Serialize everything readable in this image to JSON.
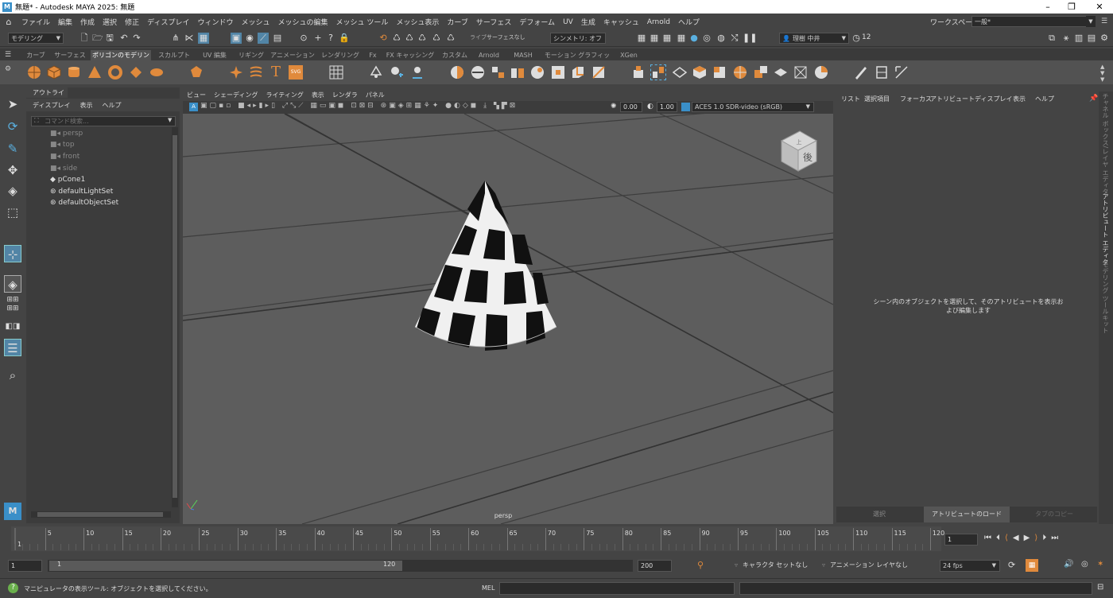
{
  "window": {
    "title": "無題* - Autodesk MAYA 2025: 無題",
    "logo": "M"
  },
  "menubar": {
    "items": [
      "ファイル",
      "編集",
      "作成",
      "選択",
      "修正",
      "ディスプレイ",
      "ウィンドウ",
      "メッシュ",
      "メッシュの編集",
      "メッシュ ツール",
      "メッシュ表示",
      "カーブ",
      "サーフェス",
      "デフォーム",
      "UV",
      "生成",
      "キャッシュ",
      "Arnold",
      "ヘルプ"
    ],
    "workspace_label": "ワークスペース:",
    "workspace_value": "一般*"
  },
  "statusline": {
    "mode": "モデリング",
    "live": "ライブ",
    "live_value": "サーフェスなし",
    "symmetry": "シンメトリ: オフ",
    "user": "理樹 中井",
    "count": "12"
  },
  "shelf": {
    "tabs": [
      "カーブ",
      "サーフェス",
      "ポリゴンのモデリング",
      "スカルプト",
      "UV 編集",
      "リギング",
      "アニメーション",
      "レンダリング",
      "Fx",
      "FX キャッシング",
      "カスタム",
      "Arnold",
      "MASH",
      "モーション グラフィックス",
      "XGen"
    ],
    "active_tab": 2,
    "text_icon": "T",
    "svg_icon": "SVG"
  },
  "outliner": {
    "tab": "アウトライナ",
    "menu": [
      "ディスプレイ",
      "表示",
      "ヘルプ"
    ],
    "search_placeholder": "コマンド検索...",
    "items": [
      {
        "label": "persp",
        "dim": true
      },
      {
        "label": "top",
        "dim": true
      },
      {
        "label": "front",
        "dim": true
      },
      {
        "label": "side",
        "dim": true
      },
      {
        "label": "pCone1",
        "dim": false
      },
      {
        "label": "defaultLightSet",
        "dim": false
      },
      {
        "label": "defaultObjectSet",
        "dim": false
      }
    ]
  },
  "viewport": {
    "menu": [
      "ビュー",
      "シェーディング",
      "ライティング",
      "表示",
      "レンダラ",
      "パネル"
    ],
    "exposure": "0.00",
    "gamma": "1.00",
    "colorspace": "ACES 1.0 SDR-video (sRGB)",
    "camera": "persp",
    "cube_label": "後",
    "cube_top": "上"
  },
  "attribute_editor": {
    "menu": [
      "リスト",
      "選択項目",
      "フォーカス",
      "アトリビュート",
      "ディスプレイ",
      "表示",
      "ヘルプ"
    ],
    "message": "シーン内のオブジェクトを選択して、そのアトリビュートを表示および編集します",
    "buttons": [
      "選択",
      "アトリビュートのロード",
      "タブのコピー"
    ]
  },
  "right_tabs": [
    "チャネル ボックス/レイヤ エディタ",
    "アトリビュート エディタ",
    "モデリング ツールキット"
  ],
  "timeline": {
    "ticks": [
      "5",
      "10",
      "15",
      "20",
      "25",
      "30",
      "35",
      "40",
      "45",
      "50",
      "55",
      "60",
      "65",
      "70",
      "75",
      "80",
      "85",
      "90",
      "95",
      "100",
      "105",
      "110",
      "115",
      "120"
    ],
    "start_marker": "1",
    "current_frame": "1"
  },
  "range": {
    "start": "1",
    "inner_start": "1",
    "inner_end": "120",
    "end": "200",
    "character": "キャラクタ セットなし",
    "anim_layer": "アニメーション レイヤなし",
    "fps": "24 fps"
  },
  "helpline": {
    "text": "マニピュレータの表示ツール: オブジェクトを選択してください。",
    "mel": "MEL"
  },
  "colors": {
    "accent": "#4a9ad8",
    "shelf_icon": "#e08a3c",
    "bg": "#444444",
    "viewport": "#5d5d5d"
  }
}
